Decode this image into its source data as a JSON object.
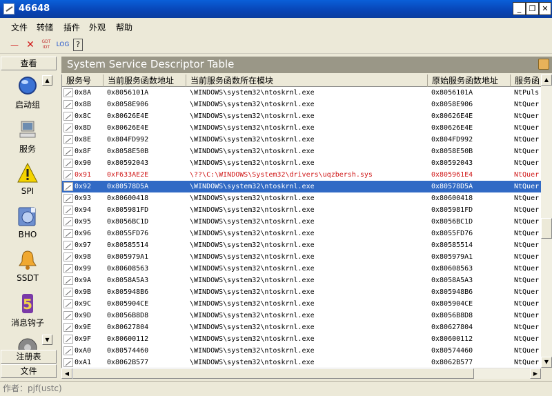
{
  "window": {
    "title": "46648",
    "minimize": "_",
    "restore": "❐",
    "close": "✕"
  },
  "menu": [
    "文件",
    "转储",
    "插件",
    "外观",
    "帮助"
  ],
  "toolbar": {
    "minus": "—",
    "close": "✕",
    "gdt_idt": "GDT IDT",
    "log": "LOG",
    "help": "?"
  },
  "sidebar": {
    "top_button": "查看",
    "items": [
      "启动组",
      "服务",
      "SPI",
      "BHO",
      "SSDT",
      "消息钩子"
    ],
    "bottom_buttons": [
      "注册表",
      "文件"
    ]
  },
  "panel": {
    "title": "System Service Descriptor Table"
  },
  "table": {
    "columns": [
      "服务号",
      "当前服务函数地址",
      "当前服务函数所在模块",
      "原始服务函数地址",
      "服务函"
    ],
    "rows": [
      {
        "id": "0x8A",
        "cur": "0x8056101A",
        "module": "\\WINDOWS\\system32\\ntoskrnl.exe",
        "orig": "0x8056101A",
        "name": "NtPuls"
      },
      {
        "id": "0x8B",
        "cur": "0x8058E906",
        "module": "\\WINDOWS\\system32\\ntoskrnl.exe",
        "orig": "0x8058E906",
        "name": "NtQuer"
      },
      {
        "id": "0x8C",
        "cur": "0x80626E4E",
        "module": "\\WINDOWS\\system32\\ntoskrnl.exe",
        "orig": "0x80626E4E",
        "name": "NtQuer"
      },
      {
        "id": "0x8D",
        "cur": "0x80626E4E",
        "module": "\\WINDOWS\\system32\\ntoskrnl.exe",
        "orig": "0x80626E4E",
        "name": "NtQuer"
      },
      {
        "id": "0x8E",
        "cur": "0x804FD992",
        "module": "\\WINDOWS\\system32\\ntoskrnl.exe",
        "orig": "0x804FD992",
        "name": "NtQuer"
      },
      {
        "id": "0x8F",
        "cur": "0x8058E50B",
        "module": "\\WINDOWS\\system32\\ntoskrnl.exe",
        "orig": "0x8058E50B",
        "name": "NtQuer"
      },
      {
        "id": "0x90",
        "cur": "0x80592043",
        "module": "\\WINDOWS\\system32\\ntoskrnl.exe",
        "orig": "0x80592043",
        "name": "NtQuer"
      },
      {
        "id": "0x91",
        "cur": "0xF633AE2E",
        "module": "\\??\\C:\\WINDOWS\\System32\\drivers\\uqzbersh.sys",
        "orig": "0x805961E4",
        "name": "NtQuer"
      },
      {
        "id": "0x92",
        "cur": "0x80578D5A",
        "module": "\\WINDOWS\\system32\\ntoskrnl.exe",
        "orig": "0x80578D5A",
        "name": "NtQuer"
      },
      {
        "id": "0x93",
        "cur": "0x80600418",
        "module": "\\WINDOWS\\system32\\ntoskrnl.exe",
        "orig": "0x80600418",
        "name": "NtQuer"
      },
      {
        "id": "0x94",
        "cur": "0x805981FD",
        "module": "\\WINDOWS\\system32\\ntoskrnl.exe",
        "orig": "0x805981FD",
        "name": "NtQuer"
      },
      {
        "id": "0x95",
        "cur": "0x8056BC1D",
        "module": "\\WINDOWS\\system32\\ntoskrnl.exe",
        "orig": "0x8056BC1D",
        "name": "NtQuer"
      },
      {
        "id": "0x96",
        "cur": "0x8055FD76",
        "module": "\\WINDOWS\\system32\\ntoskrnl.exe",
        "orig": "0x8055FD76",
        "name": "NtQuer"
      },
      {
        "id": "0x97",
        "cur": "0x80585514",
        "module": "\\WINDOWS\\system32\\ntoskrnl.exe",
        "orig": "0x80585514",
        "name": "NtQuer"
      },
      {
        "id": "0x98",
        "cur": "0x805979A1",
        "module": "\\WINDOWS\\system32\\ntoskrnl.exe",
        "orig": "0x805979A1",
        "name": "NtQuer"
      },
      {
        "id": "0x99",
        "cur": "0x80608563",
        "module": "\\WINDOWS\\system32\\ntoskrnl.exe",
        "orig": "0x80608563",
        "name": "NtQuer"
      },
      {
        "id": "0x9A",
        "cur": "0x8058A5A3",
        "module": "\\WINDOWS\\system32\\ntoskrnl.exe",
        "orig": "0x8058A5A3",
        "name": "NtQuer"
      },
      {
        "id": "0x9B",
        "cur": "0x805948B6",
        "module": "\\WINDOWS\\system32\\ntoskrnl.exe",
        "orig": "0x805948B6",
        "name": "NtQuer"
      },
      {
        "id": "0x9C",
        "cur": "0x805904CE",
        "module": "\\WINDOWS\\system32\\ntoskrnl.exe",
        "orig": "0x805904CE",
        "name": "NtQuer"
      },
      {
        "id": "0x9D",
        "cur": "0x8056B8D8",
        "module": "\\WINDOWS\\system32\\ntoskrnl.exe",
        "orig": "0x8056B8D8",
        "name": "NtQuer"
      },
      {
        "id": "0x9E",
        "cur": "0x80627804",
        "module": "\\WINDOWS\\system32\\ntoskrnl.exe",
        "orig": "0x80627804",
        "name": "NtQuer"
      },
      {
        "id": "0x9F",
        "cur": "0x80600112",
        "module": "\\WINDOWS\\system32\\ntoskrnl.exe",
        "orig": "0x80600112",
        "name": "NtQuer"
      },
      {
        "id": "0xA0",
        "cur": "0x80574460",
        "module": "\\WINDOWS\\system32\\ntoskrnl.exe",
        "orig": "0x80574460",
        "name": "NtQuer"
      },
      {
        "id": "0xA1",
        "cur": "0x8062B577",
        "module": "\\WINDOWS\\system32\\ntoskrnl.exe",
        "orig": "0x8062B577",
        "name": "NtQuer"
      }
    ]
  },
  "row_states": {
    "hooked_id": "0x91",
    "selected_id": "0x92"
  },
  "colors": {
    "hooked": "#d01818",
    "selected": "#316ac5",
    "titlebar": "#0a5fd8",
    "panel_header": "#9a9787"
  },
  "status": "作者：pjf(ustc)"
}
